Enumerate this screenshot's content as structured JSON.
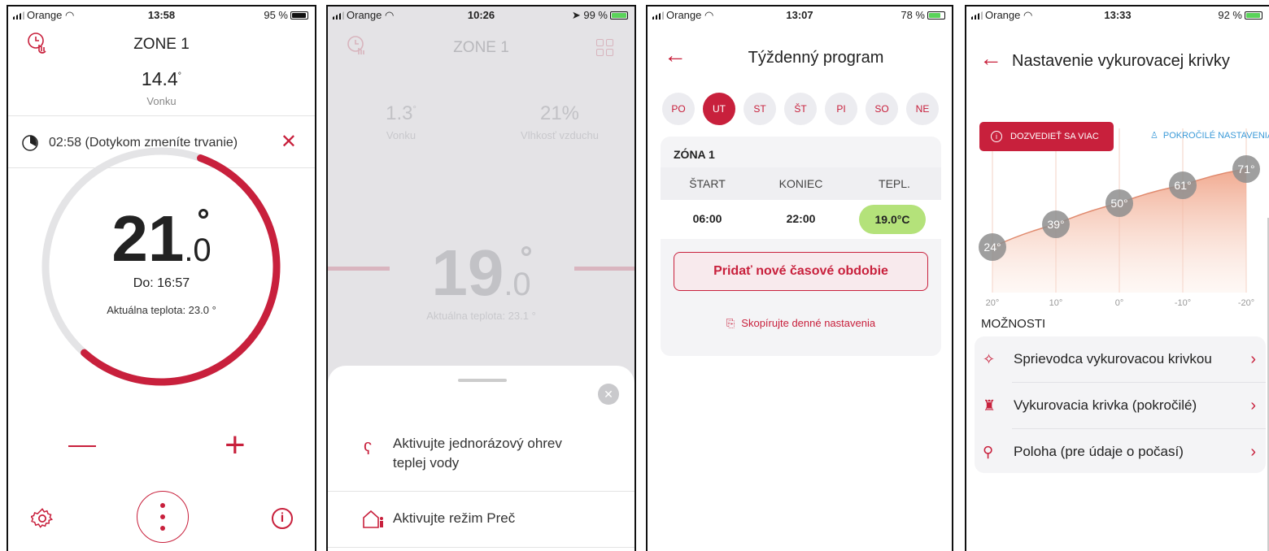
{
  "phone1": {
    "status": {
      "carrier": "Orange",
      "time": "13:58",
      "battery": "95 %"
    },
    "zone": "ZONE 1",
    "outside_temp": "14.4",
    "outside_label": "Vonku",
    "timer_text": "02:58 (Dotykom zmeníte trvanie)",
    "setpoint_int": "21",
    "setpoint_dec": ".0",
    "until": "Do: 16:57",
    "current": "Aktuálna teplota: 23.0 °",
    "progress_fraction": 0.56
  },
  "phone2": {
    "status": {
      "carrier": "Orange",
      "time": "10:26",
      "battery": "99 %"
    },
    "zone": "ZONE 1",
    "outside_temp": "1.3",
    "outside_label": "Vonku",
    "humidity": "21%",
    "humidity_label": "Vlhkosť vzduchu",
    "setpoint_int": "19",
    "setpoint_dec": ".0",
    "current": "Aktuálna teplota: 23.1 °",
    "sheet_item1": "Aktivujte jednorázový ohrev teplej vody",
    "sheet_item2": "Aktivujte režim Preč"
  },
  "phone3": {
    "status": {
      "carrier": "Orange",
      "time": "13:07",
      "battery": "78 %"
    },
    "title": "Týždenný program",
    "days": [
      "PO",
      "UT",
      "ST",
      "ŠT",
      "PI",
      "SO",
      "NE"
    ],
    "active_day": "UT",
    "zone": "ZÓNA 1",
    "col_start": "ŠTART",
    "col_end": "KONIEC",
    "col_temp": "TEPL.",
    "row_start": "06:00",
    "row_end": "22:00",
    "row_temp": "19.0°C",
    "add_button": "Pridať nové časové obdobie",
    "copy_link": "Skopírujte denné nastavenia"
  },
  "phone4": {
    "status": {
      "carrier": "Orange",
      "time": "13:33",
      "battery": "92 %"
    },
    "title": "Nastavenie vykurovacej krivky",
    "learn_more": "DOZVEDIEŤ SA VIAC",
    "advanced": "POKROČILÉ NASTAVENIA",
    "points": [
      "24°",
      "39°",
      "50°",
      "61°",
      "71°"
    ],
    "x_labels": [
      "20°",
      "10°",
      "0°",
      "-10°",
      "-20°"
    ],
    "options_title": "MOŽNOSTI",
    "options": [
      "Sprievodca vykurovacou krivkou",
      "Vykurovacia krivka (pokročilé)",
      "Poloha (pre údaje o počasí)"
    ]
  },
  "colors": {
    "accent": "#c8203c",
    "green": "#b4e27a"
  }
}
